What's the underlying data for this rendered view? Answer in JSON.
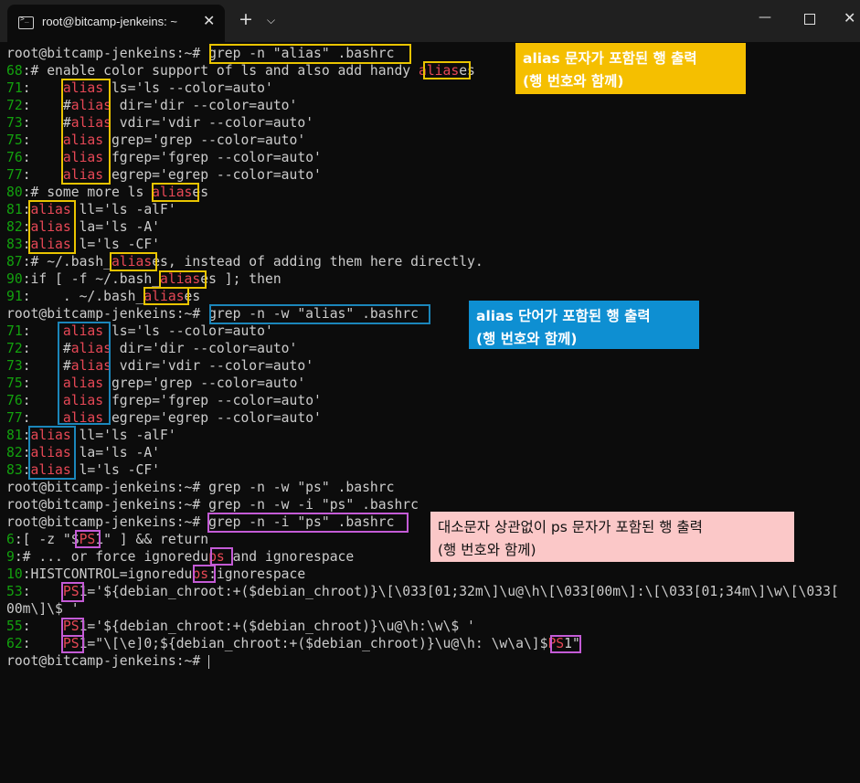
{
  "window": {
    "tab_title": "root@bitcamp-jenkeins: ~",
    "tab_close": "✕",
    "new_tab": "+",
    "dropdown": "⌵",
    "minimize": "—",
    "close": "✕"
  },
  "terminal": {
    "lines": [
      [
        [
          "",
          "root@bitcamp-jenkeins:~# grep -n \"alias\" .bashrc"
        ]
      ],
      [
        [
          "ln",
          "68"
        ],
        [
          "",
          ":# enable color support of ls and also add handy "
        ],
        [
          "hl",
          "alias"
        ],
        [
          "",
          "es"
        ]
      ],
      [
        [
          "ln",
          "71"
        ],
        [
          "",
          ":    "
        ],
        [
          "hl",
          "alias"
        ],
        [
          "",
          " ls='ls --color=auto'"
        ]
      ],
      [
        [
          "ln",
          "72"
        ],
        [
          "",
          ":    #"
        ],
        [
          "hl",
          "alias"
        ],
        [
          "",
          " dir='dir --color=auto'"
        ]
      ],
      [
        [
          "ln",
          "73"
        ],
        [
          "",
          ":    #"
        ],
        [
          "hl",
          "alias"
        ],
        [
          "",
          " vdir='vdir --color=auto'"
        ]
      ],
      [
        [
          "ln",
          "75"
        ],
        [
          "",
          ":    "
        ],
        [
          "hl",
          "alias"
        ],
        [
          "",
          " grep='grep --color=auto'"
        ]
      ],
      [
        [
          "ln",
          "76"
        ],
        [
          "",
          ":    "
        ],
        [
          "hl",
          "alias"
        ],
        [
          "",
          " fgrep='fgrep --color=auto'"
        ]
      ],
      [
        [
          "ln",
          "77"
        ],
        [
          "",
          ":    "
        ],
        [
          "hl",
          "alias"
        ],
        [
          "",
          " egrep='egrep --color=auto'"
        ]
      ],
      [
        [
          "ln",
          "80"
        ],
        [
          "",
          ":# some more ls "
        ],
        [
          "hl",
          "alias"
        ],
        [
          "",
          "es"
        ]
      ],
      [
        [
          "ln",
          "81"
        ],
        [
          "",
          ":"
        ],
        [
          "hl",
          "alias"
        ],
        [
          "",
          " ll='ls -alF'"
        ]
      ],
      [
        [
          "ln",
          "82"
        ],
        [
          "",
          ":"
        ],
        [
          "hl",
          "alias"
        ],
        [
          "",
          " la='ls -A'"
        ]
      ],
      [
        [
          "ln",
          "83"
        ],
        [
          "",
          ":"
        ],
        [
          "hl",
          "alias"
        ],
        [
          "",
          " l='ls -CF'"
        ]
      ],
      [
        [
          "ln",
          "87"
        ],
        [
          "",
          ":# ~/.bash_"
        ],
        [
          "hl",
          "alias"
        ],
        [
          "",
          "es, instead of adding them here directly."
        ]
      ],
      [
        [
          "ln",
          "90"
        ],
        [
          "",
          ":if [ -f ~/.bash_"
        ],
        [
          "hl",
          "alias"
        ],
        [
          "",
          "es ]; then"
        ]
      ],
      [
        [
          "ln",
          "91"
        ],
        [
          "",
          ":    . ~/.bash_"
        ],
        [
          "hl",
          "alias"
        ],
        [
          "",
          "es"
        ]
      ],
      [
        [
          "",
          "root@bitcamp-jenkeins:~# grep -n -w \"alias\" .bashrc"
        ]
      ],
      [
        [
          "ln",
          "71"
        ],
        [
          "",
          ":    "
        ],
        [
          "hl",
          "alias"
        ],
        [
          "",
          " ls='ls --color=auto'"
        ]
      ],
      [
        [
          "ln",
          "72"
        ],
        [
          "",
          ":    #"
        ],
        [
          "hl",
          "alias"
        ],
        [
          "",
          " dir='dir --color=auto'"
        ]
      ],
      [
        [
          "ln",
          "73"
        ],
        [
          "",
          ":    #"
        ],
        [
          "hl",
          "alias"
        ],
        [
          "",
          " vdir='vdir --color=auto'"
        ]
      ],
      [
        [
          "ln",
          "75"
        ],
        [
          "",
          ":    "
        ],
        [
          "hl",
          "alias"
        ],
        [
          "",
          " grep='grep --color=auto'"
        ]
      ],
      [
        [
          "ln",
          "76"
        ],
        [
          "",
          ":    "
        ],
        [
          "hl",
          "alias"
        ],
        [
          "",
          " fgrep='fgrep --color=auto'"
        ]
      ],
      [
        [
          "ln",
          "77"
        ],
        [
          "",
          ":    "
        ],
        [
          "hl",
          "alias"
        ],
        [
          "",
          " egrep='egrep --color=auto'"
        ]
      ],
      [
        [
          "ln",
          "81"
        ],
        [
          "",
          ":"
        ],
        [
          "hl",
          "alias"
        ],
        [
          "",
          " ll='ls -alF'"
        ]
      ],
      [
        [
          "ln",
          "82"
        ],
        [
          "",
          ":"
        ],
        [
          "hl",
          "alias"
        ],
        [
          "",
          " la='ls -A'"
        ]
      ],
      [
        [
          "ln",
          "83"
        ],
        [
          "",
          ":"
        ],
        [
          "hl",
          "alias"
        ],
        [
          "",
          " l='ls -CF'"
        ]
      ],
      [
        [
          "",
          "root@bitcamp-jenkeins:~# grep -n -w \"ps\" .bashrc"
        ]
      ],
      [
        [
          "",
          "root@bitcamp-jenkeins:~# grep -n -w -i \"ps\" .bashrc"
        ]
      ],
      [
        [
          "",
          "root@bitcamp-jenkeins:~# grep -n -i \"ps\" .bashrc"
        ]
      ],
      [
        [
          "ln",
          "6"
        ],
        [
          "",
          ":[ -z \"$"
        ],
        [
          "hl",
          "PS"
        ],
        [
          "",
          "1\" ] && return"
        ]
      ],
      [
        [
          "ln",
          "9"
        ],
        [
          "",
          ":# ... or force ignoredu"
        ],
        [
          "hl",
          "ps"
        ],
        [
          "",
          " and ignorespace"
        ]
      ],
      [
        [
          "ln",
          "10"
        ],
        [
          "",
          ":HISTCONTROL=ignoredu"
        ],
        [
          "hl",
          "ps"
        ],
        [
          "",
          ":ignorespace"
        ]
      ],
      [
        [
          "ln",
          "53"
        ],
        [
          "",
          ":    "
        ],
        [
          "hl",
          "PS"
        ],
        [
          "",
          "1='${debian_chroot:+($debian_chroot)}\\[\\033[01;32m\\]\\u@\\h\\[\\033[00m\\]:\\[\\033[01;34m\\]\\w\\[\\033["
        ]
      ],
      [
        [
          "",
          "00m\\]\\$ '"
        ]
      ],
      [
        [
          "ln",
          "55"
        ],
        [
          "",
          ":    "
        ],
        [
          "hl",
          "PS"
        ],
        [
          "",
          "1='${debian_chroot:+($debian_chroot)}\\u@\\h:\\w\\$ '"
        ]
      ],
      [
        [
          "ln",
          "62"
        ],
        [
          "",
          ":    "
        ],
        [
          "hl",
          "PS"
        ],
        [
          "",
          "1=\"\\[\\e]0;${debian_chroot:+($debian_chroot)}\\u@\\h: \\w\\a\\]$"
        ],
        [
          "hl",
          "PS"
        ],
        [
          "",
          "1\""
        ]
      ],
      [
        [
          "",
          "root@bitcamp-jenkeins:~# "
        ],
        [
          "cursor",
          ""
        ]
      ]
    ]
  },
  "annotations": {
    "callout1": "alias 문자가 포함된 행 출력\n(행 번호와 함께)",
    "callout2": "alias 단어가 포함된 행 출력\n(행 번호와 함께)",
    "callout3": "대소문자 상관없이 ps 문자가 포함된 행 출력\n(행 번호와 함께)",
    "colors": {
      "yellow": "#e9c400",
      "blue": "#1b86ba",
      "purple": "#c45bd6",
      "highlight_red": "#e74856",
      "line_number_green": "#13a10e"
    }
  }
}
